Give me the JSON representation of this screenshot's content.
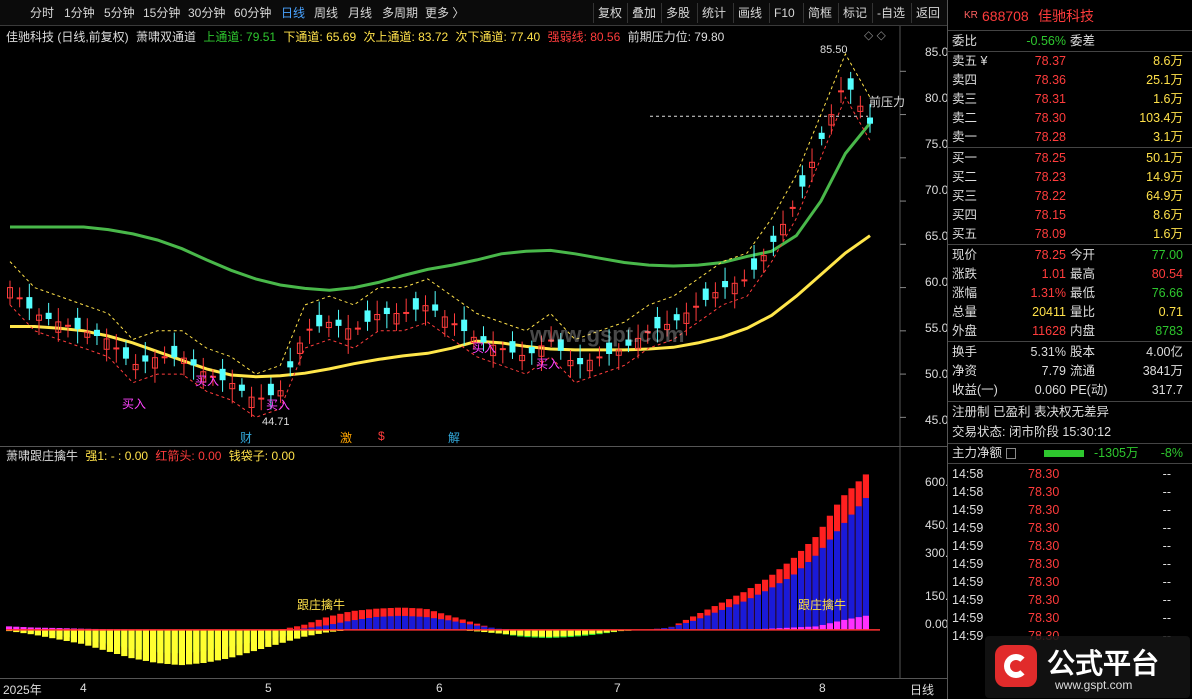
{
  "toolbar": {
    "periods": [
      "分时",
      "1分钟",
      "5分钟",
      "15分钟",
      "30分钟",
      "60分钟",
      "日线",
      "周线",
      "月线",
      "多周期",
      "更多 〉"
    ],
    "active_period": "日线",
    "buttons": [
      "复权",
      "叠加",
      "多股",
      "统计",
      "画线",
      "F10",
      "简框",
      "标记",
      "-自选",
      "返回"
    ]
  },
  "main_legend": {
    "stock": "佳驰科技 (日线,前复权)",
    "indicator": "萧啸双通道",
    "items": [
      {
        "label": "上通道: 79.51",
        "color": "#2ec72e"
      },
      {
        "label": "下通道: 65.69",
        "color": "#ffe14a"
      },
      {
        "label": "次上通道: 83.72",
        "color": "#ffe14a"
      },
      {
        "label": "次下通道: 77.40",
        "color": "#ffe14a"
      },
      {
        "label": "强弱线: 80.56",
        "color": "#ff3c3c"
      },
      {
        "label": "前期压力位: 79.80",
        "color": "#dddddd"
      }
    ]
  },
  "main_yaxis": [
    "85.00",
    "80.00",
    "75.00",
    "70.00",
    "65.00",
    "60.00",
    "55.00",
    "50.00",
    "45.00"
  ],
  "annotations": {
    "high": "85.50",
    "low": "44.71",
    "pressure": "前压力",
    "buy": "买入",
    "markers": [
      "财",
      "激",
      "$",
      "解"
    ]
  },
  "sub_legend": {
    "name": "萧啸跟庄擒牛",
    "items": [
      {
        "label": "强1: - : 0.00",
        "color": "#ffe14a"
      },
      {
        "label": "红箭头: 0.00",
        "color": "#ff3c3c"
      },
      {
        "label": "钱袋子: 0.00",
        "color": "#ffe14a"
      }
    ],
    "signal": "跟庄擒牛"
  },
  "sub_yaxis": [
    "600.00",
    "450.00",
    "300.00",
    "150.00",
    "0.00"
  ],
  "xaxis": {
    "labels": [
      "2025年",
      "4",
      "5",
      "6",
      "7",
      "8"
    ],
    "period": "日线"
  },
  "quote": {
    "market_tag": "KR",
    "code": "688708",
    "name": "佳驰科技",
    "webi_label": "委比",
    "webi": "-0.56%",
    "wecha_label": "委差",
    "wecha": "",
    "asks": [
      {
        "label": "卖五 ¥",
        "price": "78.37",
        "vol": "8.6万"
      },
      {
        "label": "卖四",
        "price": "78.36",
        "vol": "25.1万"
      },
      {
        "label": "卖三",
        "price": "78.31",
        "vol": "1.6万"
      },
      {
        "label": "卖二",
        "price": "78.30",
        "vol": "103.4万"
      },
      {
        "label": "卖一",
        "price": "78.28",
        "vol": "3.1万"
      }
    ],
    "bids": [
      {
        "label": "买一",
        "price": "78.25",
        "vol": "50.1万"
      },
      {
        "label": "买二",
        "price": "78.23",
        "vol": "14.9万"
      },
      {
        "label": "买三",
        "price": "78.22",
        "vol": "64.9万"
      },
      {
        "label": "买四",
        "price": "78.15",
        "vol": "8.6万"
      },
      {
        "label": "买五",
        "price": "78.09",
        "vol": "1.6万"
      }
    ],
    "stats": [
      {
        "l1": "现价",
        "v1": "78.25",
        "c1": "red",
        "l2": "今开",
        "v2": "77.00",
        "c2": "grn"
      },
      {
        "l1": "涨跌",
        "v1": "1.01",
        "c1": "red",
        "l2": "最高",
        "v2": "80.54",
        "c2": "red"
      },
      {
        "l1": "涨幅",
        "v1": "1.31%",
        "c1": "red",
        "l2": "最低",
        "v2": "76.66",
        "c2": "grn"
      },
      {
        "l1": "总量",
        "v1": "20411",
        "c1": "yel",
        "l2": "量比",
        "v2": "0.71",
        "c2": "yel"
      },
      {
        "l1": "外盘",
        "v1": "11628",
        "c1": "red",
        "l2": "内盘",
        "v2": "8783",
        "c2": "grn"
      }
    ],
    "stats2": [
      {
        "l1": "换手",
        "v1": "5.31%",
        "l2": "股本",
        "v2": "4.00亿"
      },
      {
        "l1": "净资",
        "v1": "7.79",
        "l2": "流通",
        "v2": "3841万"
      },
      {
        "l1": "收益(一)",
        "v1": "0.060",
        "l2": "PE(动)",
        "v2": "317.7"
      }
    ],
    "tags": "注册制 已盈利 表决权无差异",
    "trade_state": "交易状态: 闭市阶段 15:30:12",
    "main_flow_label": "主力净额",
    "main_flow": "-1305万",
    "main_flow_pct": "-8%",
    "ticks": [
      {
        "t": "14:58",
        "p": "78.30",
        "q": "--"
      },
      {
        "t": "14:58",
        "p": "78.30",
        "q": "--"
      },
      {
        "t": "14:59",
        "p": "78.30",
        "q": "--"
      },
      {
        "t": "14:59",
        "p": "78.30",
        "q": "--"
      },
      {
        "t": "14:59",
        "p": "78.30",
        "q": "--"
      },
      {
        "t": "14:59",
        "p": "78.30",
        "q": "--"
      },
      {
        "t": "14:59",
        "p": "78.30",
        "q": "--"
      },
      {
        "t": "14:59",
        "p": "78.30",
        "q": "--"
      },
      {
        "t": "14:59",
        "p": "78.30",
        "q": "--"
      },
      {
        "t": "14:59",
        "p": "78.30",
        "q": "--"
      }
    ]
  },
  "watermark": {
    "brand": "公式平台",
    "url": "www.gspt.com",
    "center": "www.gspt.com"
  },
  "chart_data": {
    "type": "candlestick",
    "ylim": [
      44,
      87
    ],
    "upper_channel": [
      67,
      67,
      67,
      67,
      66.7,
      66.2,
      65.5,
      64.5,
      63.2,
      62,
      61,
      60.3,
      59.9,
      59.7,
      60,
      60.6,
      61.4,
      62.1,
      62.6,
      63.2,
      63.9,
      64.2,
      64.3,
      63.9,
      63.4,
      62.9,
      62.6,
      62.5,
      62.6,
      62.9,
      63.6,
      64.2,
      66,
      70,
      75.5,
      79
    ],
    "lower_channel": [
      55.5,
      55.5,
      55.3,
      55,
      54.4,
      53.6,
      52.6,
      51.6,
      50.6,
      49.9,
      49.7,
      49.8,
      50.1,
      50.6,
      51.2,
      51.7,
      52.1,
      52.4,
      53,
      53.8,
      53.6,
      53.2,
      52.9,
      52.8,
      52.8,
      52.8,
      52.9,
      53.1,
      53.6,
      54.3,
      55.3,
      56.8,
      59,
      61.5,
      64,
      66
    ],
    "close": [
      60,
      57,
      56,
      55,
      54,
      51,
      52,
      52,
      50,
      49,
      47,
      48,
      55,
      56,
      55,
      57,
      57,
      58,
      56,
      54,
      53,
      52,
      54,
      51,
      52,
      53,
      55,
      56,
      58,
      60,
      61,
      65,
      70,
      77,
      84,
      79
    ]
  },
  "sub_chart_data": {
    "type": "bar",
    "ylim": [
      -200,
      700
    ],
    "pink": [
      15,
      10,
      8,
      5,
      3,
      2,
      2,
      1,
      1,
      1,
      0,
      0,
      0,
      0,
      0,
      0,
      0,
      0,
      0,
      0,
      0,
      0,
      0,
      0,
      0,
      0,
      0,
      0,
      0,
      0,
      0,
      5,
      10,
      15,
      40,
      60
    ],
    "red": [
      0,
      0,
      0,
      0,
      0,
      0,
      0,
      0,
      0,
      0,
      0,
      0,
      20,
      55,
      80,
      90,
      95,
      90,
      60,
      30,
      0,
      0,
      0,
      0,
      0,
      0,
      0,
      10,
      60,
      110,
      160,
      220,
      300,
      400,
      560,
      660
    ],
    "blue": [
      0,
      0,
      0,
      0,
      0,
      0,
      0,
      0,
      0,
      0,
      0,
      0,
      5,
      20,
      40,
      55,
      60,
      55,
      40,
      20,
      5,
      0,
      0,
      0,
      0,
      0,
      0,
      10,
      40,
      80,
      120,
      170,
      230,
      320,
      440,
      560
    ],
    "yellow": [
      -5,
      -20,
      -40,
      -60,
      -90,
      -120,
      -140,
      -150,
      -140,
      -120,
      -90,
      -60,
      -30,
      -10,
      0,
      0,
      0,
      0,
      0,
      -5,
      -15,
      -25,
      -30,
      -25,
      -15,
      -5,
      0,
      0,
      0,
      0,
      0,
      0,
      0,
      0,
      0,
      0
    ],
    "green": [
      -5,
      -15,
      -25,
      -40,
      -60,
      -80,
      -95,
      -100,
      -90,
      -70,
      -50,
      -30,
      -15,
      -5,
      0,
      0,
      0,
      0,
      0,
      -5,
      -15,
      -30,
      -35,
      -30,
      -20,
      -5,
      0,
      0,
      0,
      0,
      0,
      0,
      0,
      0,
      0,
      0
    ]
  }
}
